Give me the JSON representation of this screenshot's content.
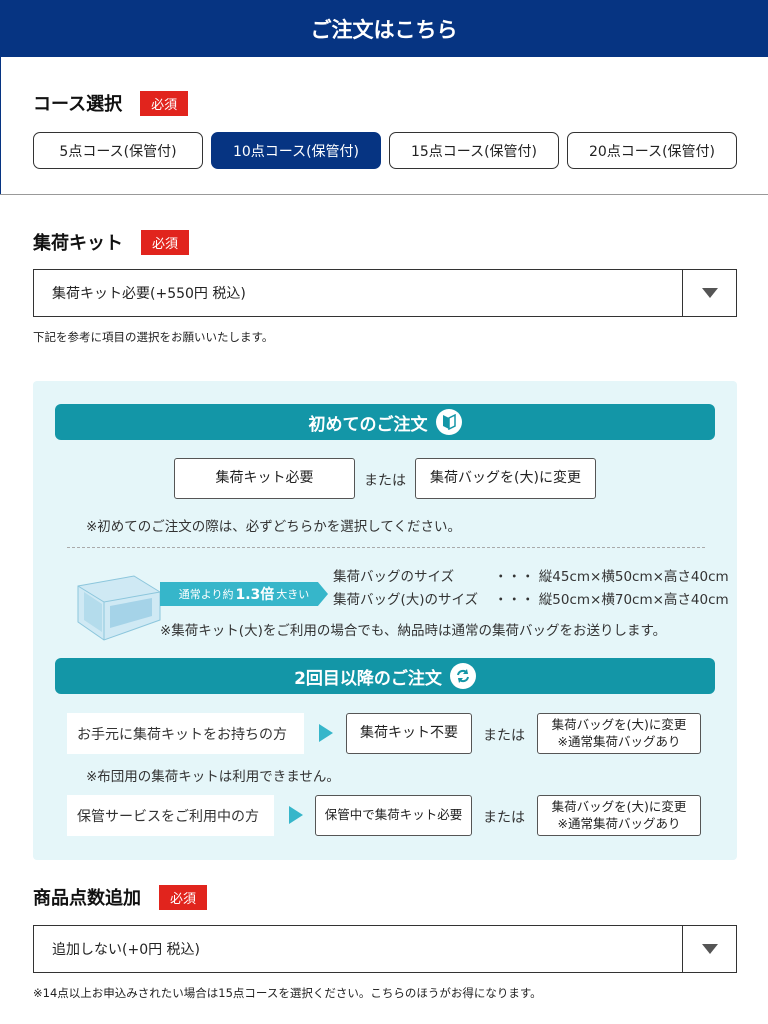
{
  "header": {
    "title": "ご注文はこちら"
  },
  "required_label": "必須",
  "course": {
    "title": "コース選択",
    "options": [
      "5点コース(保管付)",
      "10点コース(保管付)",
      "15点コース(保管付)",
      "20点コース(保管付)"
    ],
    "selected_index": 1
  },
  "kit": {
    "title": "集荷キット",
    "selected_value": "集荷キット必要(+550円 税込)",
    "note": "下記を参考に項目の選択をお願いいたします。"
  },
  "guide": {
    "first_order": {
      "banner": "初めてのご注文",
      "option_a": "集荷キット必要",
      "or": "または",
      "option_b": "集荷バッグを(大)に変更",
      "note": "※初めてのご注文の際は、必ずどちらかを選択してください。"
    },
    "bag": {
      "ribbon_prefix": "通常より約",
      "ribbon_value": "1.3倍",
      "ribbon_suffix": "大きい",
      "size_label": "集荷バッグのサイズ",
      "size_value": "・・・ 縦45cm×横50cm×高さ40cm",
      "large_label": "集荷バッグ(大)のサイズ",
      "large_value": "・・・ 縦50cm×横70cm×高さ40cm",
      "note": "※集荷キット(大)をご利用の場合でも、納品時は通常の集荷バッグをお送りします。"
    },
    "repeat_order": {
      "banner": "2回目以降のご注文",
      "row1_label": "お手元に集荷キットをお持ちの方",
      "row1_option_a": "集荷キット不要",
      "row1_or": "または",
      "row1_option_b_line1": "集荷バッグを(大)に変更",
      "row1_option_b_line2": "※通常集荷バッグあり",
      "row1_note": "※布団用の集荷キットは利用できません。",
      "row2_label": "保管サービスをご利用中の方",
      "row2_option_a": "保管中で集荷キット必要",
      "row2_or": "または",
      "row2_option_b_line1": "集荷バッグを(大)に変更",
      "row2_option_b_line2": "※通常集荷バッグあり"
    }
  },
  "items": {
    "title": "商品点数追加",
    "selected_value": "追加しない(+0円 税込)",
    "note": "※14点以上お申込みされたい場合は15点コースを選択ください。こちらのほうがお得になります。"
  },
  "colors": {
    "header": "#063482",
    "required": "#e1241d",
    "teal": "#1396a7",
    "panel": "#e5f6f9",
    "arrow": "#36b6ca"
  },
  "icons": {
    "first_order": "beginner-mark-icon",
    "repeat_order": "repeat-arrows-icon",
    "select": "triangle-down-icon"
  }
}
